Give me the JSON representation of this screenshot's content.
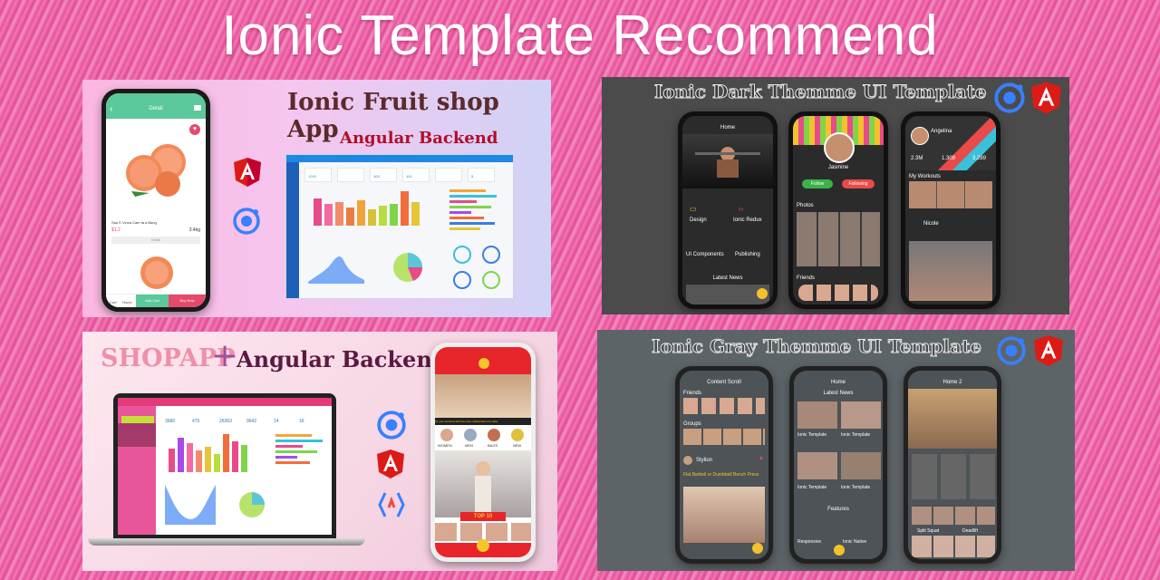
{
  "title": "Ionic Template Recommend",
  "fruit_panel": {
    "heading": "Ionic Fruit shop App",
    "subheading": "Angular Backend",
    "phone_header": "Detail",
    "product_name": "Sau K  Vinca Cam ta a Bang",
    "product_price": "$1.2",
    "product_weight": "3.4kg",
    "detail_label": "Detail",
    "btn_add": "Add Cart",
    "btn_buy": "Buy Now",
    "nav_cart": "Cart",
    "nav_home": "Home",
    "stat_values": [
      "1093",
      "103",
      "101",
      "5"
    ]
  },
  "dark_panel": {
    "heading": "Ionic Dark Themme UI Template",
    "screen1_title": "Home",
    "design": "Design",
    "ionic_redux": "Ionic Redux",
    "ui_components": "UI Components",
    "publishing": "Publishing",
    "latest_news": "Latest News",
    "profile_name": "Jasmine",
    "btn_follow": "Follow",
    "btn_following": "Following",
    "photos": "Photos",
    "friends": "Friends",
    "profile2_name": "Angelina",
    "stats": [
      "2.3M",
      "1,309",
      "3,289"
    ],
    "my_workouts": "My Workouts",
    "nicole": "Nicole"
  },
  "shop_panel": {
    "heading_a": "SHOPAPP",
    "plus": "+",
    "heading_b": "Angular Backend",
    "stats": [
      "3680",
      "475",
      "26363",
      "9642",
      "14",
      "16"
    ],
    "categories": [
      "WOMEN",
      "MEN",
      "BAGS",
      "NEW"
    ],
    "top_label": "TOP 10",
    "ticker": "for your workout with the ionic collaboration it's Ultra"
  },
  "gray_panel": {
    "heading": "Ionic Gray Themme UI Template",
    "s1_title": "Content Scroll",
    "s1_friends": "Friends",
    "s1_groups": "Groups",
    "s1_user": "Stylion",
    "s1_post": "Flat Barbell or Dumbbell Bench Press",
    "s2_title": "Home",
    "s2_latest": "Latest News",
    "s2_item": "Ionic Template",
    "s2_features": "Features",
    "s2_f1": "Responsive",
    "s2_f2": "Ionic Native",
    "s3_title": "Home 2",
    "s3_a": "Split Squat",
    "s3_b": "Deadlift"
  }
}
